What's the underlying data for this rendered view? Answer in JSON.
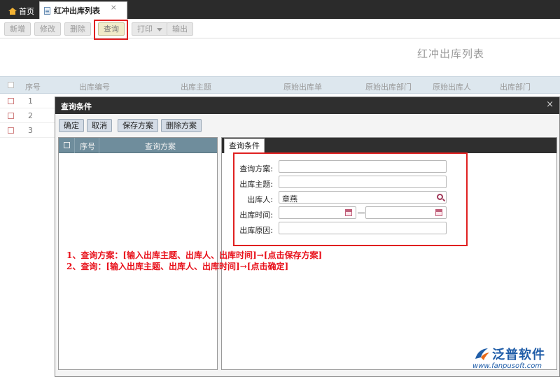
{
  "tabs": {
    "home": "首页",
    "active": "红冲出库列表",
    "close": "×"
  },
  "toolbar": {
    "add": "新增",
    "edit": "修改",
    "delete": "删除",
    "query": "查询",
    "print": "打印",
    "export": "输出"
  },
  "page_title": "红冲出库列表",
  "table": {
    "columns": [
      "序号",
      "出库编号",
      "出库主题",
      "原始出库单",
      "原始出库部门",
      "原始出库人",
      "出库部门"
    ],
    "rows": [
      {
        "num": "1"
      },
      {
        "num": "2"
      },
      {
        "num": "3"
      }
    ]
  },
  "modal": {
    "title": "查询条件",
    "close": "×",
    "buttons": {
      "confirm": "确定",
      "cancel": "取消",
      "save_plan": "保存方案",
      "delete_plan": "删除方案"
    },
    "plan_list": {
      "col_num": "序号",
      "col_plan": "查询方案"
    },
    "condition_tab": "查询条件",
    "fields": {
      "plan_label": "查询方案:",
      "subject_label": "出库主题:",
      "person_label": "出库人:",
      "person_value": "章燕",
      "time_label": "出库时间:",
      "reason_label": "出库原因:"
    }
  },
  "instructions": [
    "1、查询方案：[输入出库主题、出库人、出库时间]→[点击保存方案]",
    "2、查询：[输入出库主题、出库人、出库时间]→[点击确定]"
  ],
  "logo": {
    "name": "泛普软件",
    "url": "www.fanpusoft.com"
  },
  "colors": {
    "highlight_border": "#e02020",
    "instruction_text": "#e8101a",
    "brand": "#1f5da8"
  }
}
